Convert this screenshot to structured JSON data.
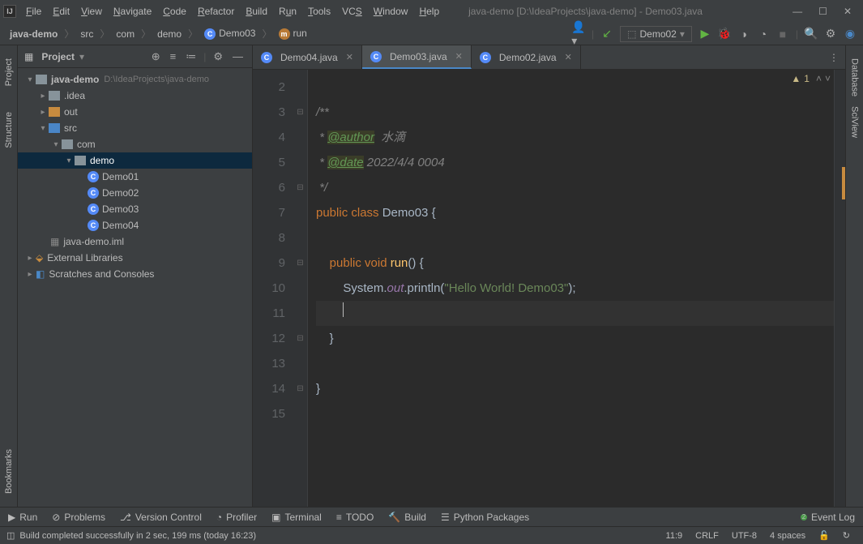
{
  "window": {
    "title": "java-demo [D:\\IdeaProjects\\java-demo] - Demo03.java"
  },
  "menu": [
    "File",
    "Edit",
    "View",
    "Navigate",
    "Code",
    "Refactor",
    "Build",
    "Run",
    "Tools",
    "VCS",
    "Window",
    "Help"
  ],
  "breadcrumb": {
    "root": "java-demo",
    "p1": "src",
    "p2": "com",
    "p3": "demo",
    "cls": "Demo03",
    "method": "run"
  },
  "run_config": "Demo02",
  "project_panel": {
    "title": "Project",
    "root": "java-demo",
    "root_path": "D:\\IdeaProjects\\java-demo",
    "idea": ".idea",
    "out": "out",
    "src": "src",
    "com": "com",
    "demo": "demo",
    "files": [
      "Demo01",
      "Demo02",
      "Demo03",
      "Demo04"
    ],
    "iml": "java-demo.iml",
    "ext_lib": "External Libraries",
    "scratches": "Scratches and Consoles"
  },
  "tabs": [
    {
      "label": "Demo04.java",
      "active": false
    },
    {
      "label": "Demo03.java",
      "active": true
    },
    {
      "label": "Demo02.java",
      "active": false
    }
  ],
  "editor": {
    "lines": [
      "2",
      "3",
      "4",
      "5",
      "6",
      "7",
      "8",
      "9",
      "10",
      "11",
      "12",
      "13",
      "14",
      "15"
    ],
    "warn_count": "1",
    "code": {
      "l3": "/**",
      "l4a": " * ",
      "l4b": "@author",
      "l4c": "  水滴",
      "l5a": " * ",
      "l5b": "@date",
      "l5c": " 2022/4/4 0004",
      "l6": " */",
      "l7a": "public class ",
      "l7b": "Demo03 ",
      "l7c": "{",
      "l9a": "    public void ",
      "l9b": "run",
      "l9c": "() {",
      "l10a": "        System.",
      "l10b": "out",
      "l10c": ".println(",
      "l10d": "\"Hello World! Demo03\"",
      "l10e": ");",
      "l12": "    }",
      "l14": "}"
    }
  },
  "bottom": {
    "run": "Run",
    "problems": "Problems",
    "vcs": "Version Control",
    "profiler": "Profiler",
    "terminal": "Terminal",
    "todo": "TODO",
    "build": "Build",
    "python": "Python Packages",
    "event_log": "Event Log",
    "event_count": "2"
  },
  "status": {
    "msg": "Build completed successfully in 2 sec, 199 ms (today 16:23)",
    "pos": "11:9",
    "sep": "CRLF",
    "enc": "UTF-8",
    "indent": "4 spaces"
  },
  "left_tabs": {
    "project": "Project",
    "structure": "Structure",
    "bookmarks": "Bookmarks"
  },
  "right_tabs": {
    "database": "Database",
    "sciview": "SciView"
  }
}
